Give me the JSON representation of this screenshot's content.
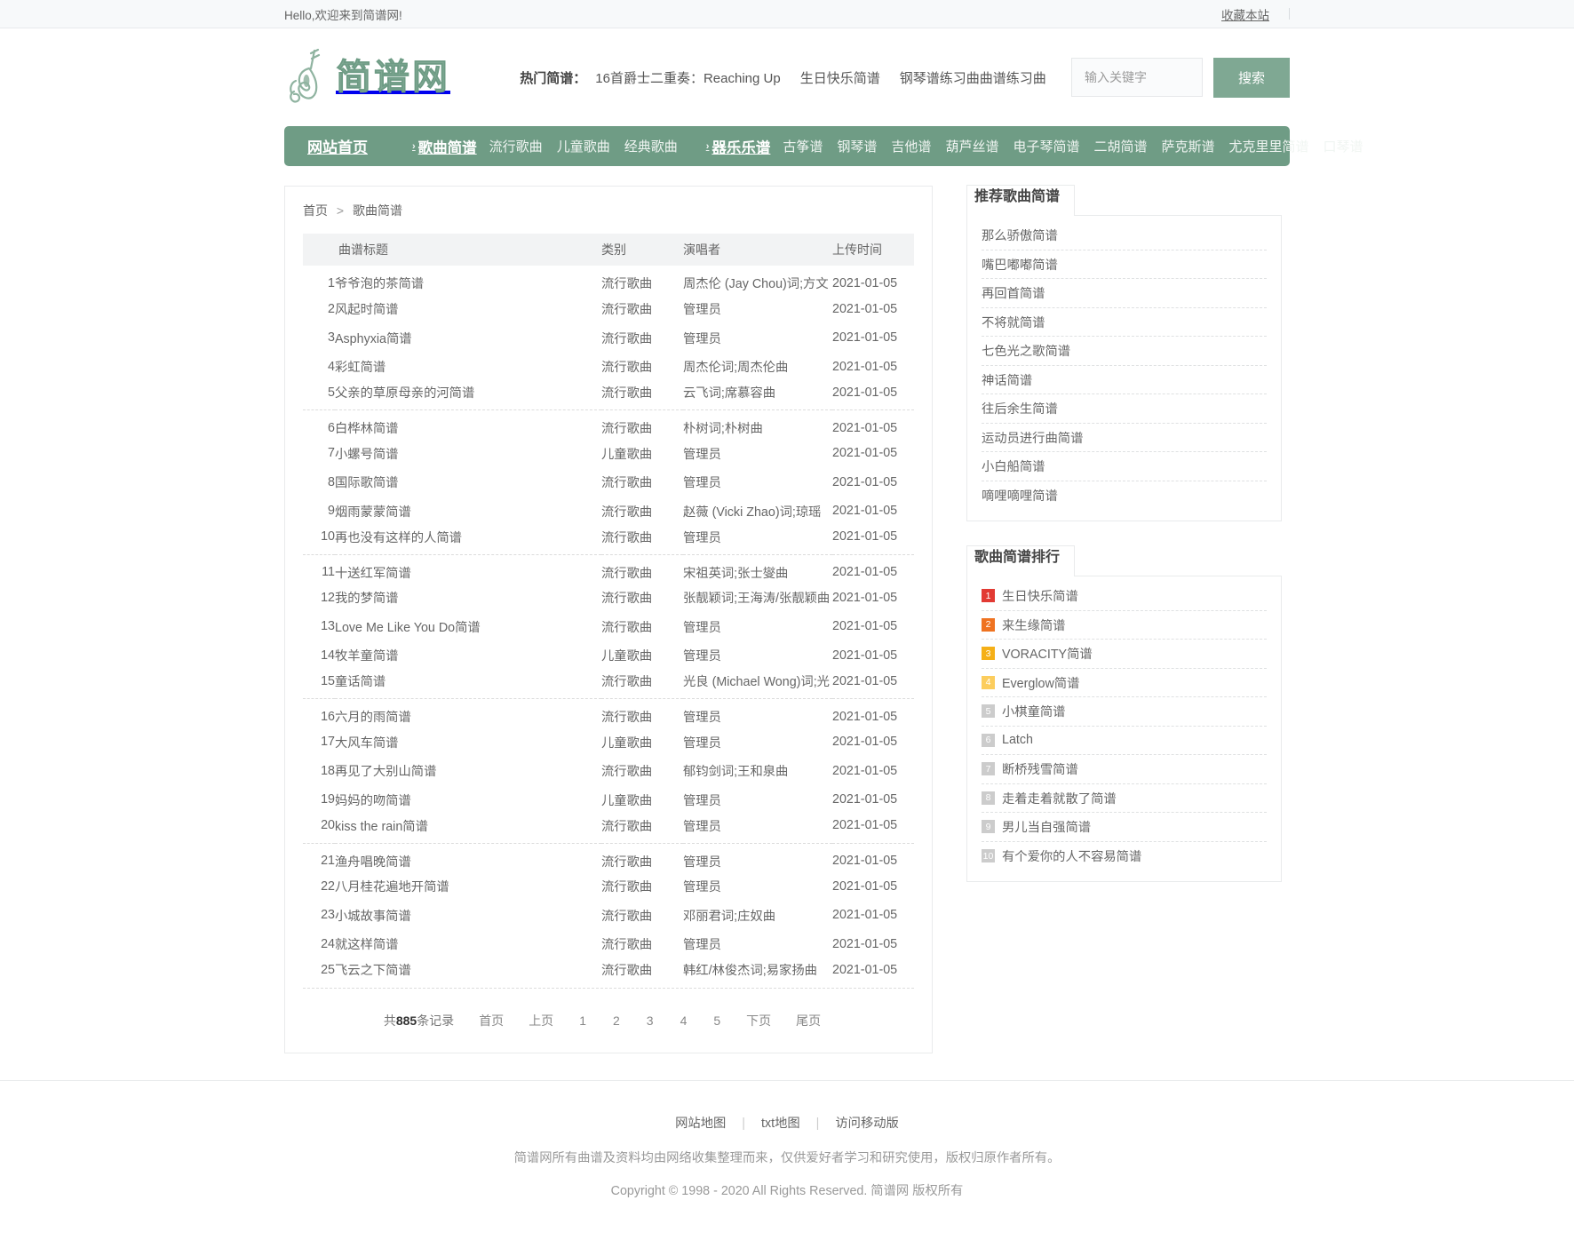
{
  "topbar": {
    "greeting": "Hello,欢迎来到简谱网!",
    "favorite": "收藏本站"
  },
  "header": {
    "logo_text": "简谱网",
    "logo_icon": "violin-icon",
    "hot_label": "热门简谱：",
    "hot_links": [
      "16首爵士二重奏：Reaching Up",
      "生日快乐简谱",
      "钢琴谱练习曲曲谱练习曲"
    ],
    "search": {
      "placeholder": "输入关键字",
      "value": "",
      "button": "搜索"
    }
  },
  "nav": {
    "home": "网站首页",
    "groups": [
      {
        "head": "歌曲简谱",
        "items": [
          "流行歌曲",
          "儿童歌曲",
          "经典歌曲"
        ]
      },
      {
        "head": "器乐乐谱",
        "items": [
          "古筝谱",
          "钢琴谱",
          "吉他谱",
          "葫芦丝谱",
          "电子琴简谱",
          "二胡简谱",
          "萨克斯谱",
          "尤克里里简谱",
          "口琴谱"
        ]
      }
    ]
  },
  "breadcrumb": {
    "home": "首页",
    "sep": ">",
    "current": "歌曲简谱"
  },
  "table": {
    "headers": [
      "曲谱标题",
      "类别",
      "演唱者",
      "上传时间"
    ],
    "rows": [
      {
        "n": "1",
        "title": "爷爷泡的茶简谱",
        "cat": "流行歌曲",
        "artist": "周杰伦 (Jay Chou)词;方文",
        "date": "2021-01-05"
      },
      {
        "n": "2",
        "title": "风起时简谱",
        "cat": "流行歌曲",
        "artist": "管理员",
        "date": "2021-01-05"
      },
      {
        "n": "3",
        "title": "Asphyxia简谱",
        "cat": "流行歌曲",
        "artist": "管理员",
        "date": "2021-01-05"
      },
      {
        "n": "4",
        "title": "彩虹简谱",
        "cat": "流行歌曲",
        "artist": "周杰伦词;周杰伦曲",
        "date": "2021-01-05"
      },
      {
        "n": "5",
        "title": "父亲的草原母亲的河简谱",
        "cat": "流行歌曲",
        "artist": "云飞词;席慕容曲",
        "date": "2021-01-05"
      },
      {
        "n": "6",
        "title": "白桦林简谱",
        "cat": "流行歌曲",
        "artist": "朴树词;朴树曲",
        "date": "2021-01-05"
      },
      {
        "n": "7",
        "title": "小螺号简谱",
        "cat": "儿童歌曲",
        "artist": "管理员",
        "date": "2021-01-05"
      },
      {
        "n": "8",
        "title": "国际歌简谱",
        "cat": "流行歌曲",
        "artist": "管理员",
        "date": "2021-01-05"
      },
      {
        "n": "9",
        "title": "烟雨蒙蒙简谱",
        "cat": "流行歌曲",
        "artist": "赵薇 (Vicki Zhao)词;琼瑶",
        "date": "2021-01-05"
      },
      {
        "n": "10",
        "title": "再也没有这样的人简谱",
        "cat": "流行歌曲",
        "artist": "管理员",
        "date": "2021-01-05"
      },
      {
        "n": "11",
        "title": "十送红军简谱",
        "cat": "流行歌曲",
        "artist": "宋祖英词;张士燮曲",
        "date": "2021-01-05"
      },
      {
        "n": "12",
        "title": "我的梦简谱",
        "cat": "流行歌曲",
        "artist": "张靓颖词;王海涛/张靓颖曲",
        "date": "2021-01-05"
      },
      {
        "n": "13",
        "title": "Love Me Like You Do简谱",
        "cat": "流行歌曲",
        "artist": "管理员",
        "date": "2021-01-05"
      },
      {
        "n": "14",
        "title": "牧羊童简谱",
        "cat": "儿童歌曲",
        "artist": "管理员",
        "date": "2021-01-05"
      },
      {
        "n": "15",
        "title": "童话简谱",
        "cat": "流行歌曲",
        "artist": "光良 (Michael Wong)词;光",
        "date": "2021-01-05"
      },
      {
        "n": "16",
        "title": "六月的雨简谱",
        "cat": "流行歌曲",
        "artist": "管理员",
        "date": "2021-01-05"
      },
      {
        "n": "17",
        "title": "大风车简谱",
        "cat": "儿童歌曲",
        "artist": "管理员",
        "date": "2021-01-05"
      },
      {
        "n": "18",
        "title": "再见了大别山简谱",
        "cat": "流行歌曲",
        "artist": "郁钧剑词;王和泉曲",
        "date": "2021-01-05"
      },
      {
        "n": "19",
        "title": "妈妈的吻简谱",
        "cat": "儿童歌曲",
        "artist": "管理员",
        "date": "2021-01-05"
      },
      {
        "n": "20",
        "title": "kiss the rain简谱",
        "cat": "流行歌曲",
        "artist": "管理员",
        "date": "2021-01-05"
      },
      {
        "n": "21",
        "title": "渔舟唱晚简谱",
        "cat": "流行歌曲",
        "artist": "管理员",
        "date": "2021-01-05"
      },
      {
        "n": "22",
        "title": "八月桂花遍地开简谱",
        "cat": "流行歌曲",
        "artist": "管理员",
        "date": "2021-01-05"
      },
      {
        "n": "23",
        "title": "小城故事简谱",
        "cat": "流行歌曲",
        "artist": "邓丽君词;庄奴曲",
        "date": "2021-01-05"
      },
      {
        "n": "24",
        "title": "就这样简谱",
        "cat": "流行歌曲",
        "artist": "管理员",
        "date": "2021-01-05"
      },
      {
        "n": "25",
        "title": "飞云之下简谱",
        "cat": "流行歌曲",
        "artist": "韩红/林俊杰词;易家扬曲",
        "date": "2021-01-05"
      }
    ]
  },
  "pager": {
    "total_prefix": "共",
    "total_count": "885",
    "total_suffix": "条记录",
    "first": "首页",
    "prev": "上页",
    "pages": [
      "1",
      "2",
      "3",
      "4",
      "5"
    ],
    "next": "下页",
    "last": "尾页"
  },
  "sidebar": {
    "recommend": {
      "title": "推荐歌曲简谱",
      "items": [
        "那么骄傲简谱",
        "嘴巴嘟嘟简谱",
        "再回首简谱",
        "不将就简谱",
        "七色光之歌简谱",
        "神话简谱",
        "往后余生简谱",
        "运动员进行曲简谱",
        "小白船简谱",
        "嘀哩嘀哩简谱"
      ]
    },
    "ranking": {
      "title": "歌曲简谱排行",
      "items": [
        {
          "rank": "1",
          "label": "生日快乐简谱",
          "color": "#e23a33"
        },
        {
          "rank": "2",
          "label": "来生缘简谱",
          "color": "#ef7321"
        },
        {
          "rank": "3",
          "label": "VORACITY简谱",
          "color": "#f5b018"
        },
        {
          "rank": "4",
          "label": "Everglow简谱",
          "color": "#fccd5d"
        },
        {
          "rank": "5",
          "label": "小棋童简谱",
          "color": "#cccccc"
        },
        {
          "rank": "6",
          "label": "Latch",
          "color": "#cccccc"
        },
        {
          "rank": "7",
          "label": "断桥残雪简谱",
          "color": "#cccccc"
        },
        {
          "rank": "8",
          "label": "走着走着就散了简谱",
          "color": "#cccccc"
        },
        {
          "rank": "9",
          "label": "男儿当自强简谱",
          "color": "#cccccc"
        },
        {
          "rank": "10",
          "label": "有个爱你的人不容易简谱",
          "color": "#cccccc"
        }
      ]
    }
  },
  "footer": {
    "links": [
      "网站地图",
      "txt地图",
      "访问移动版"
    ],
    "note": "简谱网所有曲谱及资料均由网络收集整理而来，仅供爱好者学习和研究使用，版权归原作者所有。",
    "copyright": "Copyright © 1998 - 2020 All Rights Reserved. 简谱网 版权所有"
  },
  "colors": {
    "brand_green": "#6f9c85",
    "logo_green": "#7fa893",
    "index_red": "#d07b72"
  }
}
